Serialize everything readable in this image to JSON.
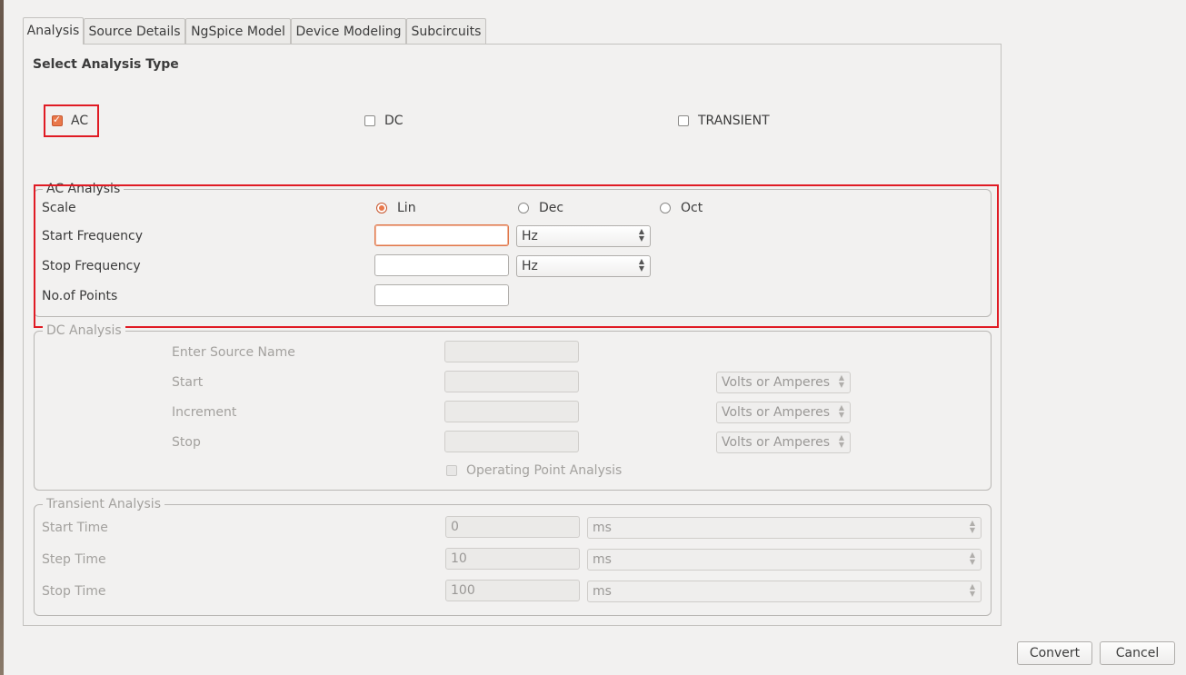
{
  "tabs": [
    {
      "label": "Analysis"
    },
    {
      "label": "Source Details"
    },
    {
      "label": "NgSpice Model"
    },
    {
      "label": "Device Modeling"
    },
    {
      "label": "Subcircuits"
    }
  ],
  "select_analysis": {
    "title": "Select Analysis Type",
    "options": [
      {
        "label": "AC",
        "checked": true
      },
      {
        "label": "DC",
        "checked": false
      },
      {
        "label": "TRANSIENT",
        "checked": false
      }
    ]
  },
  "ac": {
    "legend": "AC Analysis",
    "scale_label": "Scale",
    "scale_options": [
      {
        "label": "Lin",
        "selected": true
      },
      {
        "label": "Dec",
        "selected": false
      },
      {
        "label": "Oct",
        "selected": false
      }
    ],
    "start_freq_label": "Start Frequency",
    "start_freq_value": "",
    "start_freq_unit": "Hz",
    "stop_freq_label": "Stop Frequency",
    "stop_freq_value": "",
    "stop_freq_unit": "Hz",
    "points_label": "No.of Points",
    "points_value": ""
  },
  "dc": {
    "legend": "DC Analysis",
    "source_label": "Enter Source Name",
    "start_label": "Start",
    "increment_label": "Increment",
    "stop_label": "Stop",
    "unit": "Volts or Amperes",
    "op_label": "Operating Point Analysis"
  },
  "transient": {
    "legend": "Transient Analysis",
    "start_label": "Start Time",
    "start_value": "0",
    "start_unit": "ms",
    "step_label": "Step Time",
    "step_value": "10",
    "step_unit": "ms",
    "stop_label": "Stop Time",
    "stop_value": "100",
    "stop_unit": "ms"
  },
  "buttons": {
    "convert": "Convert",
    "cancel": "Cancel"
  },
  "colors": {
    "accent": "#e9784a",
    "highlight": "#e01b24"
  }
}
